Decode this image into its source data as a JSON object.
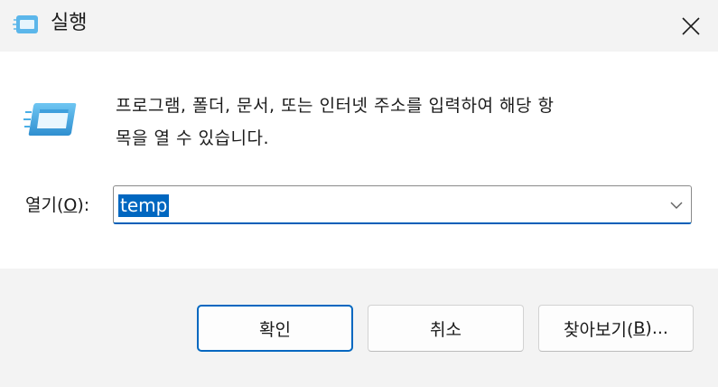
{
  "window": {
    "title": "실행",
    "title_icon": "run-icon",
    "close_icon": "close-icon"
  },
  "content": {
    "icon": "run-icon",
    "description_line1": "프로그램, 폴더, 문서, 또는 인터넷 주소를 입력하여 해당 항",
    "description_line2": "목을 열 수 있습니다.",
    "open_label_prefix": "열기(",
    "open_label_accel": "O",
    "open_label_suffix": "):",
    "open_value": "temp",
    "dropdown_icon": "chevron-down-icon"
  },
  "buttons": {
    "ok": "확인",
    "cancel": "취소",
    "browse_prefix": "찾아보기(",
    "browse_accel": "B",
    "browse_suffix": ")..."
  },
  "colors": {
    "accent": "#0067c0",
    "content_bg": "#ffffff",
    "chrome_bg": "#f3f3f3"
  }
}
